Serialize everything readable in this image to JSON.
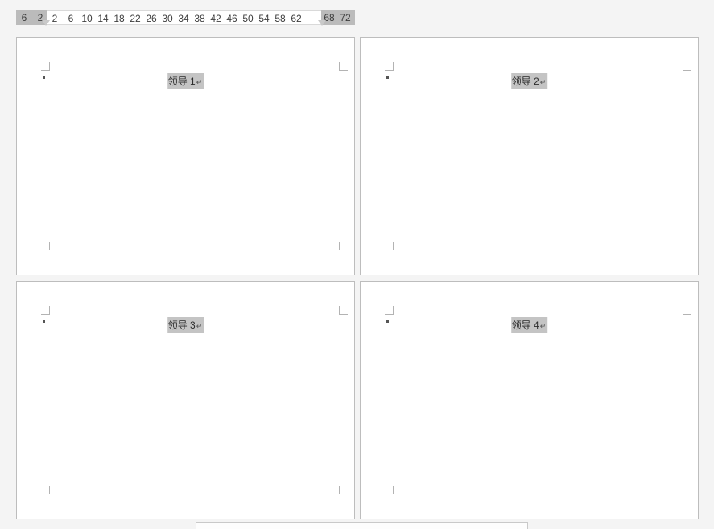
{
  "ruler": {
    "left_gray_nums": [
      "6",
      "2"
    ],
    "right_gray_nums": [
      "68",
      "72"
    ],
    "white_nums": [
      "2",
      "6",
      "10",
      "14",
      "18",
      "22",
      "26",
      "30",
      "34",
      "38",
      "42",
      "46",
      "50",
      "54",
      "58",
      "62"
    ]
  },
  "pages": [
    {
      "heading": "领导 1",
      "para_mark": "↵"
    },
    {
      "heading": "领导 2",
      "para_mark": "↵"
    },
    {
      "heading": "领导 3",
      "para_mark": "↵"
    },
    {
      "heading": "领导 4",
      "para_mark": "↵"
    }
  ]
}
